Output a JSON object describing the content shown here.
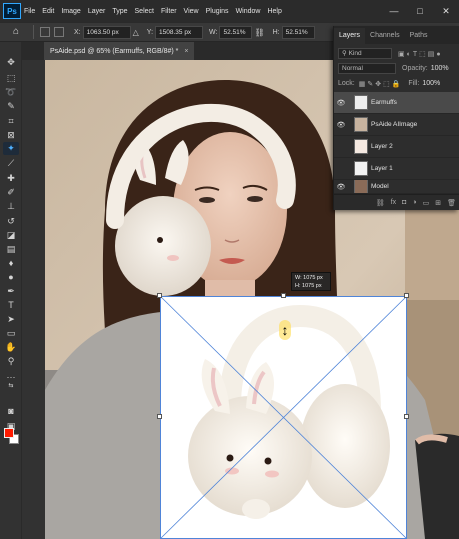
{
  "app": {
    "logo": "Ps",
    "menu": [
      "File",
      "Edit",
      "Image",
      "Layer",
      "Type",
      "Select",
      "Filter",
      "View",
      "Plugins",
      "Window",
      "Help"
    ],
    "window_controls": [
      "—",
      "□",
      "✕"
    ]
  },
  "options_bar": {
    "x_label": "X:",
    "x_value": "1063.50 px",
    "y_label": "Y:",
    "y_value": "1508.35 px",
    "w_label": "W:",
    "w_value": "52.51%",
    "h_label": "H:",
    "h_value": "52.51%"
  },
  "document": {
    "tab_title": "PsAide.psd @ 65% (Earmuffs, RGB/8#) *",
    "tab_close": "×"
  },
  "layers_panel": {
    "tabs": [
      "Layers",
      "Channels",
      "Paths"
    ],
    "filter_placeholder": "Kind",
    "blend_mode": "Normal",
    "opacity_label": "Opacity:",
    "opacity_value": "100%",
    "lock_label": "Lock:",
    "fill_label": "Fill:",
    "fill_value": "100%",
    "layers": [
      {
        "name": "Earmuffs",
        "visible": true,
        "selected": true
      },
      {
        "name": "PsAide AIImage",
        "visible": true,
        "selected": false
      },
      {
        "name": "Layer 2",
        "visible": false,
        "selected": false
      },
      {
        "name": "Layer 1",
        "visible": false,
        "selected": false
      },
      {
        "name": "Model",
        "visible": true,
        "selected": false
      }
    ],
    "bottom_icons": [
      "link-icon",
      "fx-icon",
      "mask-icon",
      "adjustment-icon",
      "group-icon",
      "new-layer-icon",
      "trash-icon"
    ],
    "bottom_glyphs": [
      "⛓",
      "fx",
      "◘",
      "◑",
      "▭",
      "⊞",
      "🗑"
    ]
  },
  "transform_tooltip": {
    "w": "W: 1075 px",
    "h": "H: 1075 px"
  },
  "colors": {
    "foreground": "#ff1a00",
    "background": "#ffffff",
    "accent": "#31a8ff"
  }
}
